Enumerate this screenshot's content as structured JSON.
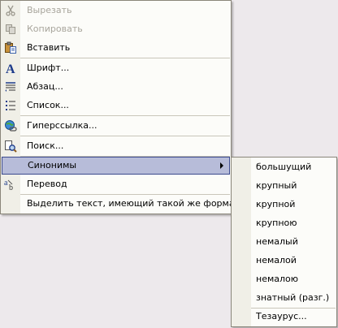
{
  "main_menu": {
    "items": [
      {
        "label": "Вырезать",
        "disabled": true,
        "icon": "scissors-icon"
      },
      {
        "label": "Копировать",
        "disabled": true,
        "icon": "copy-icon"
      },
      {
        "label": "Вставить",
        "disabled": false,
        "icon": "paste-icon"
      },
      {
        "label": "Шрифт...",
        "disabled": false,
        "icon": "font-icon"
      },
      {
        "label": "Абзац...",
        "disabled": false,
        "icon": "paragraph-icon"
      },
      {
        "label": "Список...",
        "disabled": false,
        "icon": "list-icon"
      },
      {
        "label": "Гиперссылка...",
        "disabled": false,
        "icon": "hyperlink-icon"
      },
      {
        "label": "Поиск...",
        "disabled": false,
        "icon": "search-icon"
      },
      {
        "label": "Синонимы",
        "disabled": false,
        "icon": "",
        "highlighted": true
      },
      {
        "label": "Перевод",
        "disabled": false,
        "icon": "translate-icon"
      },
      {
        "label": "Выделить текст, имеющий такой же формат",
        "disabled": false,
        "icon": ""
      }
    ]
  },
  "synonyms_menu": {
    "items": [
      "большущий",
      "крупный",
      "крупной",
      "крупною",
      "немалый",
      "немалой",
      "немалою",
      "знатный (разг.)"
    ],
    "thesaurus_label": "Тезаурус..."
  },
  "colors": {
    "highlight": "#b7bcd9",
    "highlight_border": "#3b4a8e",
    "disabled_text": "#a8a59c"
  }
}
